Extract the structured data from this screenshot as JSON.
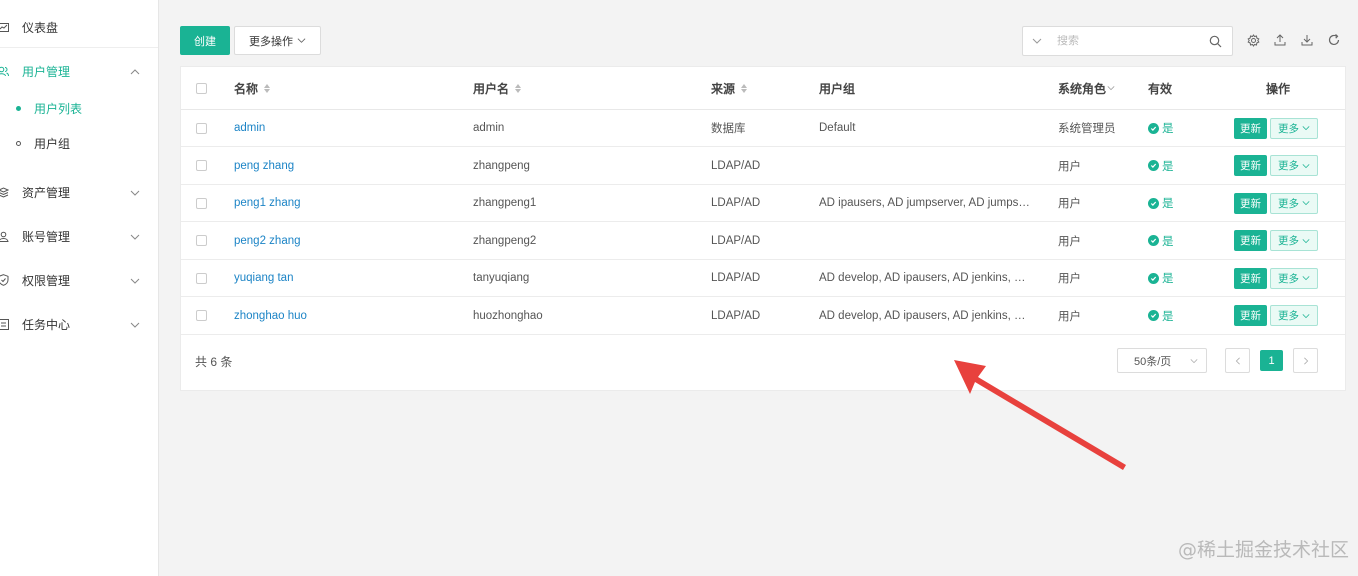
{
  "sidebar": {
    "items": [
      {
        "label": "仪表盘",
        "icon": "dashboard-icon"
      },
      {
        "label": "用户管理",
        "icon": "users-icon",
        "active": true,
        "expanded": true
      },
      {
        "label": "资产管理",
        "icon": "assets-icon"
      },
      {
        "label": "账号管理",
        "icon": "account-icon"
      },
      {
        "label": "权限管理",
        "icon": "shield-icon"
      },
      {
        "label": "任务中心",
        "icon": "task-icon"
      }
    ],
    "sub_items": [
      {
        "label": "用户列表",
        "active": true
      },
      {
        "label": "用户组",
        "active": false
      }
    ]
  },
  "toolbar": {
    "create_label": "创建",
    "more_ops_label": "更多操作",
    "search_placeholder": "搜索"
  },
  "table": {
    "headers": {
      "name": "名称",
      "username": "用户名",
      "source": "来源",
      "group": "用户组",
      "role": "系统角色",
      "valid": "有效",
      "action": "操作"
    },
    "rows": [
      {
        "name": "admin",
        "username": "admin",
        "source": "数据库",
        "group": "Default",
        "role": "系统管理员",
        "valid": "是"
      },
      {
        "name": "peng zhang",
        "username": "zhangpeng",
        "source": "LDAP/AD",
        "group": "",
        "role": "用户",
        "valid": "是"
      },
      {
        "name": "peng1 zhang",
        "username": "zhangpeng1",
        "source": "LDAP/AD",
        "group": "AD ipausers, AD jumpserver, AD jumps…",
        "role": "用户",
        "valid": "是"
      },
      {
        "name": "peng2 zhang",
        "username": "zhangpeng2",
        "source": "LDAP/AD",
        "group": "",
        "role": "用户",
        "valid": "是"
      },
      {
        "name": "yuqiang tan",
        "username": "tanyuqiang",
        "source": "LDAP/AD",
        "group": "AD develop, AD ipausers, AD jenkins, …",
        "role": "用户",
        "valid": "是"
      },
      {
        "name": "zhonghao huo",
        "username": "huozhonghao",
        "source": "LDAP/AD",
        "group": "AD develop, AD ipausers, AD jenkins, …",
        "role": "用户",
        "valid": "是"
      }
    ],
    "update_label": "更新",
    "more_label": "更多"
  },
  "pagination": {
    "total": "共 6 条",
    "page_size": "50条/页",
    "current_page": "1"
  },
  "watermark": "@稀土掘金技术社区",
  "colors": {
    "accent": "#1ab394",
    "link": "#1c84c6",
    "arrow": "#e8413d"
  }
}
